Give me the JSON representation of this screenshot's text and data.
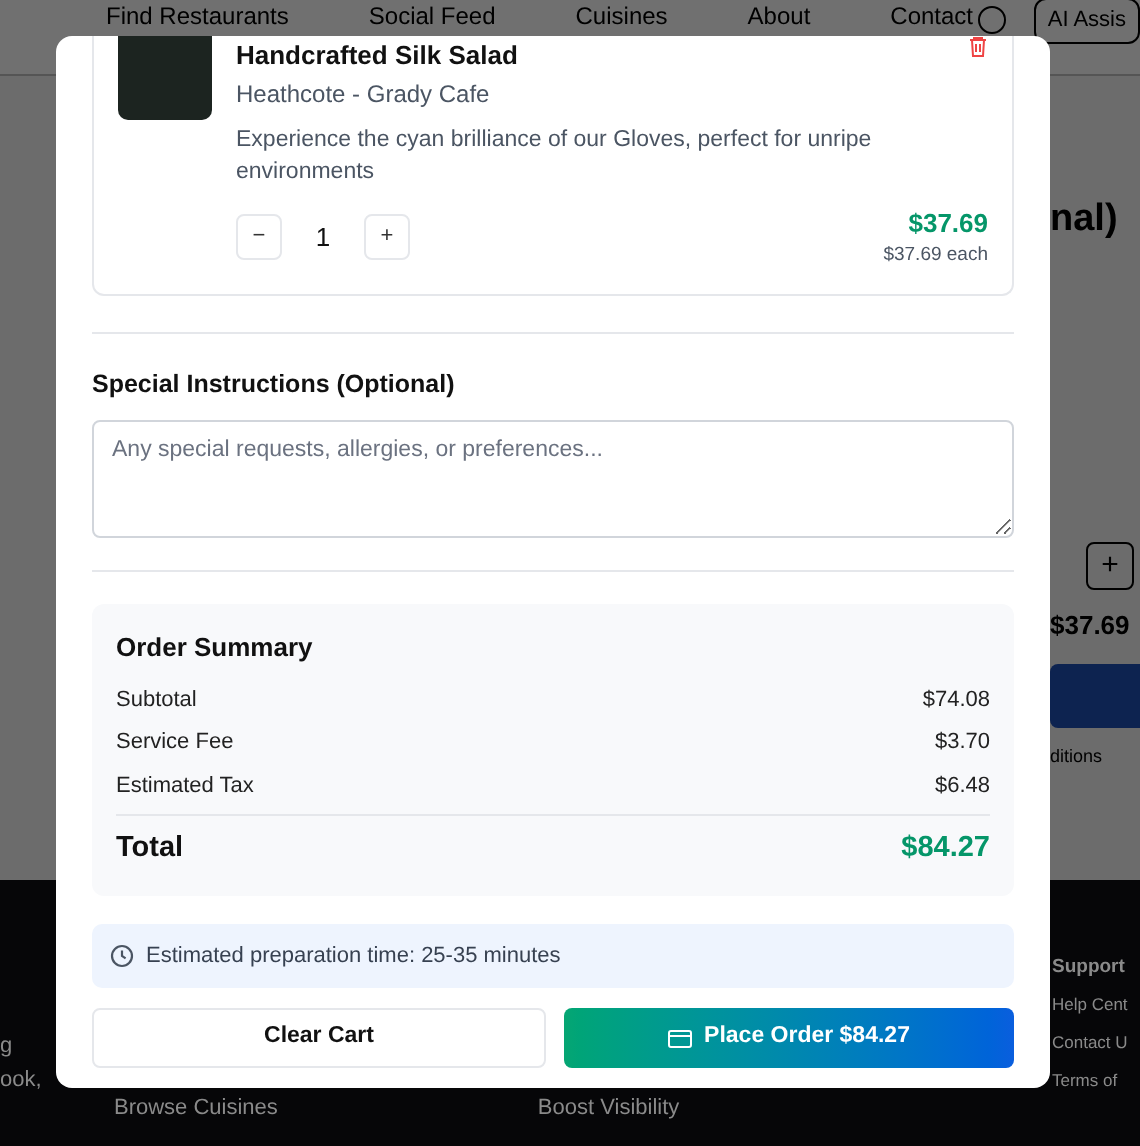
{
  "background": {
    "nav": [
      "Find Restaurants",
      "Social Feed",
      "Cuisines",
      "About",
      "Contact"
    ],
    "assistant_button": "AI Assis",
    "heading_fragment": "nal)",
    "plus": "+",
    "price_fragment": "$37.69",
    "link_fragment": "ditions",
    "footer_left": [
      "g",
      "ook,"
    ],
    "footer_links": [
      "Browse Cuisines",
      "Boost Visibility"
    ],
    "footer_heading": "Support",
    "support_links": [
      "Help Cent",
      "Contact U",
      "Terms of"
    ]
  },
  "cart_item": {
    "name": "Handcrafted Silk Salad",
    "restaurant": "Heathcote - Grady Cafe",
    "description": "Experience the cyan brilliance of our Gloves, perfect for unripe environments",
    "minus": "−",
    "quantity": "1",
    "plus": "+",
    "price": "$37.69",
    "unit_price": "$37.69 each"
  },
  "special_instructions": {
    "label": "Special Instructions (Optional)",
    "placeholder": "Any special requests, allergies, or preferences..."
  },
  "order_summary": {
    "title": "Order Summary",
    "rows": [
      {
        "label": "Subtotal",
        "value": "$74.08"
      },
      {
        "label": "Service Fee",
        "value": "$3.70"
      },
      {
        "label": "Estimated Tax",
        "value": "$6.48"
      }
    ],
    "total_label": "Total",
    "total_value": "$84.27"
  },
  "prep_time": "Estimated preparation time: 25-35 minutes",
  "buttons": {
    "clear": "Clear Cart",
    "place": "Place Order $84.27"
  }
}
